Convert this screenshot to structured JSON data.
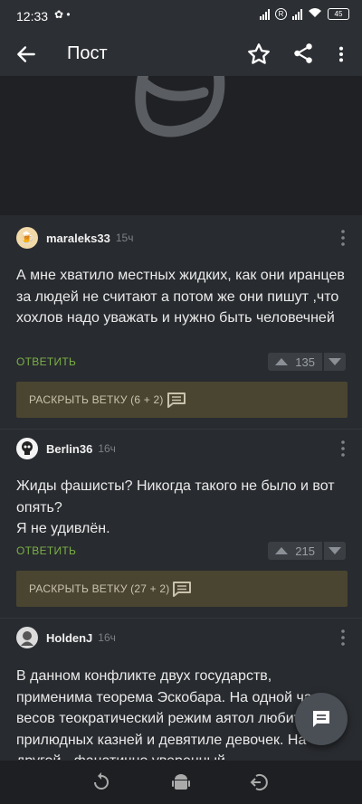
{
  "status": {
    "time": "12:33",
    "battery": "45"
  },
  "appbar": {
    "title": "Пост"
  },
  "comments": [
    {
      "user": "maraleks33",
      "time": "15ч",
      "text": "А мне хватило местных жидких, как они иранцев за людей не считают а потом же они пишут ,что хохлов надо уважать и нужно быть человечней",
      "reply": "ОТВЕТИТЬ",
      "rating": "135",
      "expand": "РАСКРЫТЬ ВЕТКУ (6 + 2)"
    },
    {
      "user": "Berlin36",
      "time": "16ч",
      "text_lines": [
        "Жиды фашисты? Никогда такого не было и вот опять?",
        "Я не удивлён."
      ],
      "reply": "ОТВЕТИТЬ",
      "rating": "215",
      "expand": "РАСКРЫТЬ ВЕТКУ (27 + 2)"
    },
    {
      "user": "HoldenJ",
      "time": "16ч",
      "text": "В данном конфликте двух государств, применима теорема Эскобара. На одной чаше весов теократический режим аятол любителей прилюдных казней и девятиле девочек. На другой - фанатично уверенный"
    }
  ],
  "icons": {
    "back": "arrow-left-icon",
    "star": "star-icon",
    "share": "share-icon",
    "more": "more-vert-icon",
    "comment": "comment-icon",
    "fab": "message-icon"
  }
}
